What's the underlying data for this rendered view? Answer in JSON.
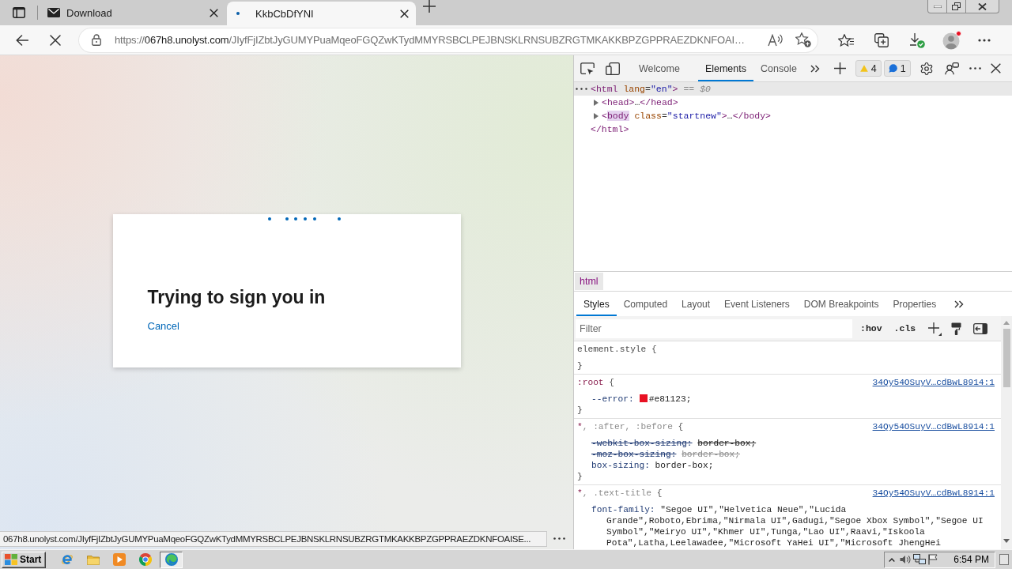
{
  "browser": {
    "tabs": [
      {
        "kind": "mail",
        "title": "Download",
        "selected": false
      },
      {
        "kind": "loading",
        "title": "KkbCbDfYNI",
        "selected": true
      }
    ],
    "loading": true,
    "address": {
      "scheme": "https://",
      "host": "067h8.unolyst.com",
      "path": "/JIyfFjIZbtJyGUMYPuaMqeoFGQZwKTydMMYRSBCLPEJBNSKLRNSUBZRGTMKAKKBPZGPPRAEZDKNFOAI…"
    }
  },
  "page": {
    "title": "Trying to sign you in",
    "cancel": "Cancel",
    "status_url": "067h8.unolyst.com/JIyfFjIZbtJyGUMYPuaMqeoFGQZwKTydMMYRSBCLPEJBNSKLRNSUBZRGTMKAKKBPZGPPRAEZDKNFOAISE..."
  },
  "devtools": {
    "tabs": [
      {
        "label": "Welcome",
        "selected": false
      },
      {
        "label": "Elements",
        "selected": true
      },
      {
        "label": "Console",
        "selected": false
      }
    ],
    "issues": [
      {
        "kind": "warning",
        "count": "4"
      },
      {
        "kind": "info",
        "count": "1"
      }
    ],
    "dom": [
      {
        "selected": true,
        "tokens": [
          {
            "kind": "tag",
            "text": "<html"
          },
          {
            "kind": "attr",
            "text": " lang"
          },
          {
            "kind": "punct",
            "text": "="
          },
          {
            "kind": "value",
            "text": "\"en\""
          },
          {
            "kind": "tag",
            "text": ">"
          }
        ],
        "marker": "== $0",
        "children": [
          {
            "selected": false,
            "expanded": false,
            "tokens": [
              {
                "kind": "tag",
                "text": "<head>"
              },
              {
                "kind": "punct",
                "text": "…"
              },
              {
                "kind": "tag",
                "text": "</head>"
              }
            ]
          },
          {
            "selected": false,
            "expanded": false,
            "tokens": [
              {
                "kind": "tag",
                "text": "<"
              },
              {
                "kind": "match",
                "text": "body"
              },
              {
                "kind": "attr",
                "text": " class"
              },
              {
                "kind": "punct",
                "text": "="
              },
              {
                "kind": "value",
                "text": "\"startnew\""
              },
              {
                "kind": "tag",
                "text": ">"
              },
              {
                "kind": "punct",
                "text": "…"
              },
              {
                "kind": "tag",
                "text": "</body>"
              }
            ]
          }
        ],
        "closing": [
          {
            "kind": "tag",
            "text": "</html>"
          }
        ]
      }
    ],
    "breadcrumb": "html",
    "pane_tabs": [
      {
        "label": "Styles",
        "selected": true
      },
      {
        "label": "Computed",
        "selected": false
      },
      {
        "label": "Layout",
        "selected": false
      },
      {
        "label": "Event Listeners",
        "selected": false
      },
      {
        "label": "DOM Breakpoints",
        "selected": false
      },
      {
        "label": "Properties",
        "selected": false
      }
    ],
    "filter": {
      "placeholder": "Filter"
    },
    "toggles": [
      ":hov",
      ".cls"
    ],
    "rules": [
      {
        "selector": [
          {
            "kind": "inline",
            "text": "element.style"
          }
        ],
        "open": "{",
        "close": "}"
      },
      {
        "selector": [
          {
            "kind": "match",
            "text": ":root"
          }
        ],
        "open": "{",
        "close": "}",
        "source": "34Qy54OSuyV…cdBwL8914:1",
        "declarations": [
          {
            "kind": "normal",
            "name": "--error:",
            "value": "#e81123;",
            "color": "#e81123"
          }
        ]
      },
      {
        "selector": [
          {
            "kind": "match",
            "text": "*"
          },
          {
            "kind": "nomatch",
            "text": ", :after, :before"
          }
        ],
        "open": "{",
        "close": "}",
        "source": "34Qy54OSuyV…cdBwL8914:1",
        "declarations": [
          {
            "kind": "overridden",
            "name": "-webkit-box-sizing:",
            "value": "border-box;"
          },
          {
            "kind": "unsupported",
            "name": "-moz-box-sizing:",
            "value": "border-box;"
          },
          {
            "kind": "normal",
            "name": "box-sizing:",
            "value": "border-box;"
          }
        ]
      },
      {
        "selector": [
          {
            "kind": "match",
            "text": "*"
          },
          {
            "kind": "nomatch",
            "text": ", .text-title"
          }
        ],
        "open": "{",
        "source": "34Qy54OSuyV…cdBwL8914:1",
        "declarations": [
          {
            "kind": "normal",
            "name": "font-family:",
            "value": "\"Segoe UI\",\"Helvetica Neue\",\"Lucida Grande\",Roboto,Ebrima,\"Nirmala UI\",Gadugi,\"Segoe Xbox Symbol\",\"Segoe UI Symbol\",\"Meiryo UI\",\"Khmer UI\",Tunga,\"Lao UI\",Raavi,\"Iskoola Pota\",Latha,Leelawadee,\"Microsoft YaHei UI\",\"Microsoft JhengHei"
          }
        ]
      }
    ]
  },
  "taskbar": {
    "start": "Start",
    "apps": [
      {
        "kind": "ie",
        "selected": false
      },
      {
        "kind": "folder",
        "selected": false
      },
      {
        "kind": "media",
        "selected": false
      },
      {
        "kind": "chrome",
        "selected": false
      },
      {
        "kind": "edge",
        "selected": true
      }
    ],
    "clock": "6:54 PM"
  }
}
